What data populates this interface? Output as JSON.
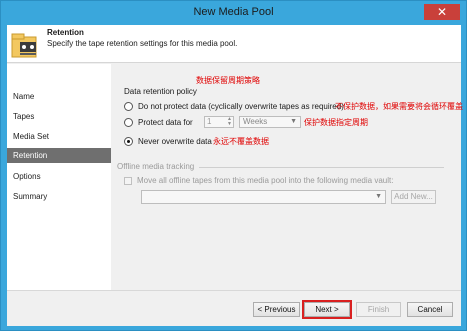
{
  "window": {
    "title": "New Media Pool",
    "close_glyph": "✕"
  },
  "header": {
    "title": "Retention",
    "subtitle": "Specify the tape retention settings for this media pool.",
    "icon": "tape-pool-icon"
  },
  "nav": {
    "items": [
      {
        "label": "Name",
        "active": false
      },
      {
        "label": "Tapes",
        "active": false
      },
      {
        "label": "Media Set",
        "active": false
      },
      {
        "label": "Retention",
        "active": true
      },
      {
        "label": "Options",
        "active": false
      },
      {
        "label": "Summary",
        "active": false
      }
    ]
  },
  "annotations": {
    "policy_note": "数据保留周期策略",
    "do_not_protect_note": "不保护数据，如果需要将会循环覆盖",
    "protect_for_note": "保护数据指定周期",
    "never_overwrite_note": "永远不覆盖数据"
  },
  "retention": {
    "policy_label": "Data retention policy",
    "options": {
      "do_not_protect": "Do not protect data (cyclically overwrite tapes as required)",
      "protect_for": "Protect data for",
      "never_overwrite": "Never overwrite data"
    },
    "selected": "never_overwrite",
    "protect_period_value": "1",
    "protect_period_unit": "Weeks"
  },
  "offline": {
    "section_label": "Offline media tracking",
    "move_label": "Move all offline tapes from this media pool into the following media vault:",
    "vault_value": "",
    "add_new_label": "Add New..."
  },
  "footer": {
    "previous_label": "< Previous",
    "next_label": "Next >",
    "finish_label": "Finish",
    "cancel_label": "Cancel"
  },
  "colors": {
    "title_bar": "#3aa7dc",
    "nav_active": "#6f6f6f",
    "annotation": "#e00000",
    "close_button": "#c9403a"
  }
}
